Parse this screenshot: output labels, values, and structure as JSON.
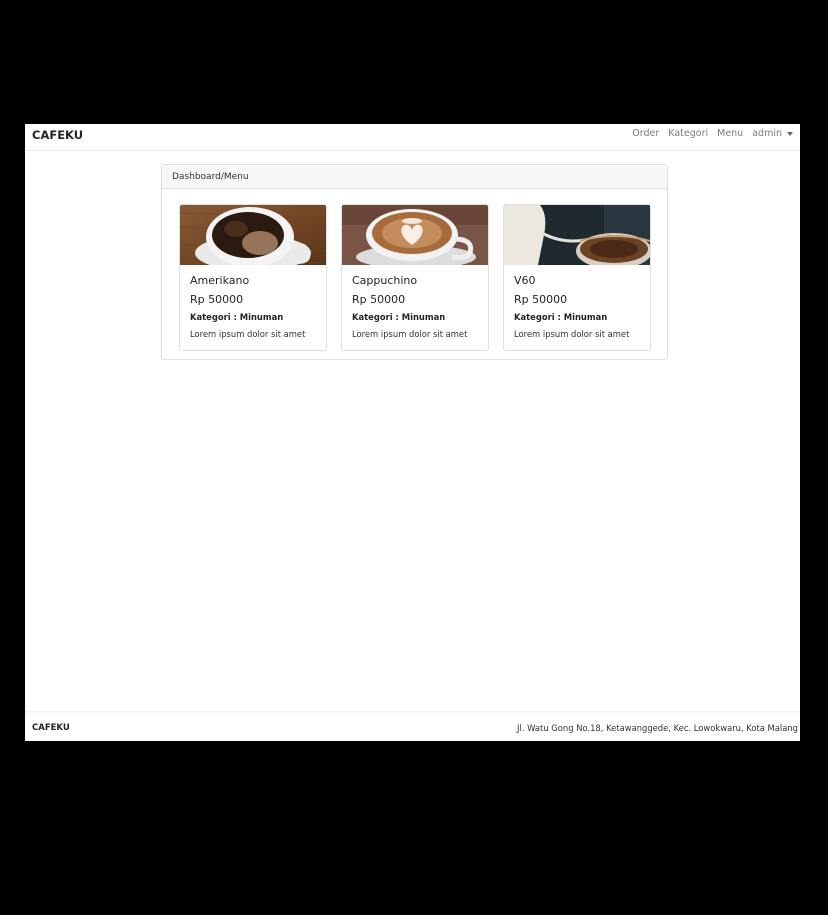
{
  "navbar": {
    "brand": "CAFEKU",
    "links": [
      "Order",
      "Kategori",
      "Menu"
    ],
    "user": "admin"
  },
  "panel": {
    "breadcrumb": "Dashboard/Menu"
  },
  "menu_items": [
    {
      "name": "Amerikano",
      "price": "Rp 50000",
      "category": "Kategori : Minuman",
      "description": "Lorem ipsum dolor sit amet",
      "image_icon": "black-coffee-cup-image"
    },
    {
      "name": "Cappuchino",
      "price": "Rp 50000",
      "category": "Kategori : Minuman",
      "description": "Lorem ipsum dolor sit amet",
      "image_icon": "latte-art-cup-image"
    },
    {
      "name": "V60",
      "price": "Rp 50000",
      "category": "Kategori : Minuman",
      "description": "Lorem ipsum dolor sit amet",
      "image_icon": "pour-over-kettle-image"
    }
  ],
  "footer": {
    "brand": "CAFEKU",
    "address": "Jl. Watu Gong No.18, Ketawanggede, Kec. Lowokwaru, Kota Malang"
  }
}
